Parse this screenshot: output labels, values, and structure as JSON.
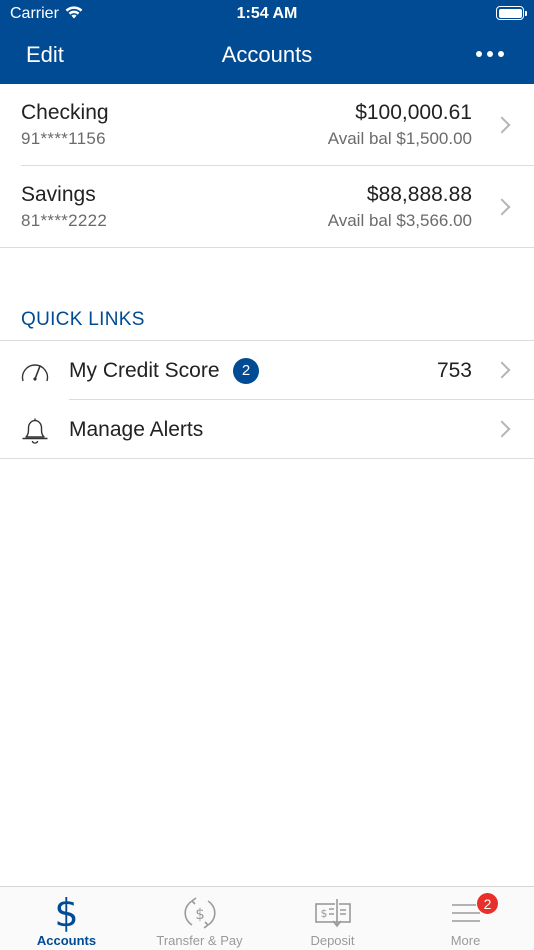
{
  "status_bar": {
    "carrier": "Carrier",
    "time": "1:54 AM"
  },
  "nav": {
    "edit_label": "Edit",
    "title": "Accounts",
    "more_icon": "ellipsis-icon"
  },
  "accounts": [
    {
      "name": "Checking",
      "number": "91****1156",
      "balance": "$100,000.61",
      "available": "Avail bal $1,500.00"
    },
    {
      "name": "Savings",
      "number": "81****2222",
      "balance": "$88,888.88",
      "available": "Avail bal $3,566.00"
    }
  ],
  "quick_links": {
    "heading": "QUICK LINKS",
    "items": [
      {
        "label": "My Credit Score",
        "badge": "2",
        "value": "753",
        "icon": "speedometer-icon"
      },
      {
        "label": "Manage Alerts",
        "icon": "bell-icon"
      }
    ]
  },
  "tab_bar": {
    "tabs": [
      {
        "label": "Accounts",
        "icon": "dollar-icon",
        "active": true
      },
      {
        "label": "Transfer & Pay",
        "icon": "transfer-icon"
      },
      {
        "label": "Deposit",
        "icon": "check-deposit-icon"
      },
      {
        "label": "More",
        "icon": "menu-icon",
        "badge": "2"
      }
    ]
  },
  "colors": {
    "brand": "#004b93",
    "badge_red": "#e8302b",
    "muted": "#9a9a9a"
  }
}
